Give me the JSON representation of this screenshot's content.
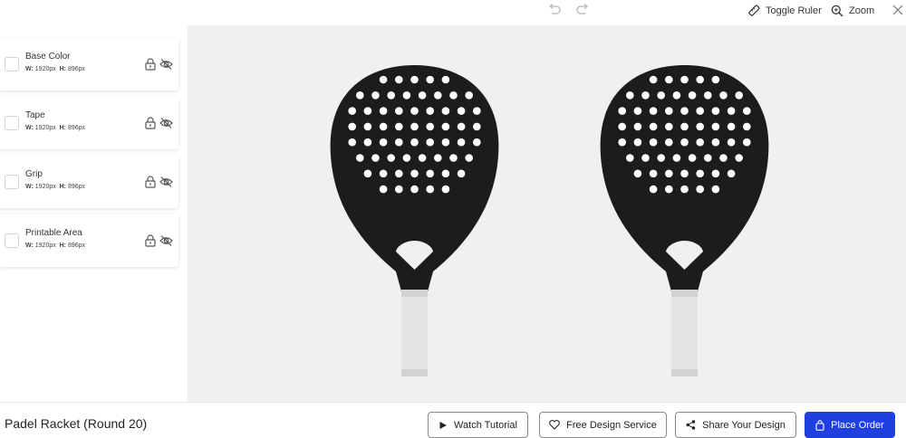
{
  "toolbar": {
    "undo_icon": "undo-icon",
    "redo_icon": "redo-icon",
    "toggle_ruler_label": "Toggle Ruler",
    "zoom_label": "Zoom",
    "close_icon": "close-icon"
  },
  "layers": [
    {
      "name": "Base Color",
      "w_label": "W:",
      "w_value": "1920px",
      "h_label": "H:",
      "h_value": "896px"
    },
    {
      "name": "Tape",
      "w_label": "W:",
      "w_value": "1920px",
      "h_label": "H:",
      "h_value": "896px"
    },
    {
      "name": "Grip",
      "w_label": "W:",
      "w_value": "1920px",
      "h_label": "H:",
      "h_value": "896px"
    },
    {
      "name": "Printable Area",
      "w_label": "W:",
      "w_value": "1920px",
      "h_label": "H:",
      "h_value": "896px"
    }
  ],
  "canvas": {
    "background": "#f0f0f0",
    "racket_face_color": "#1c1c1c",
    "grip_color": "#e4e4e4"
  },
  "footer": {
    "product_title": "Padel Racket (Round 20)",
    "watch_tutorial": "Watch Tutorial",
    "free_design_service": "Free Design Service",
    "share_your_design": "Share Your Design",
    "place_order": "Place Order",
    "accent": "#1f3fde"
  }
}
